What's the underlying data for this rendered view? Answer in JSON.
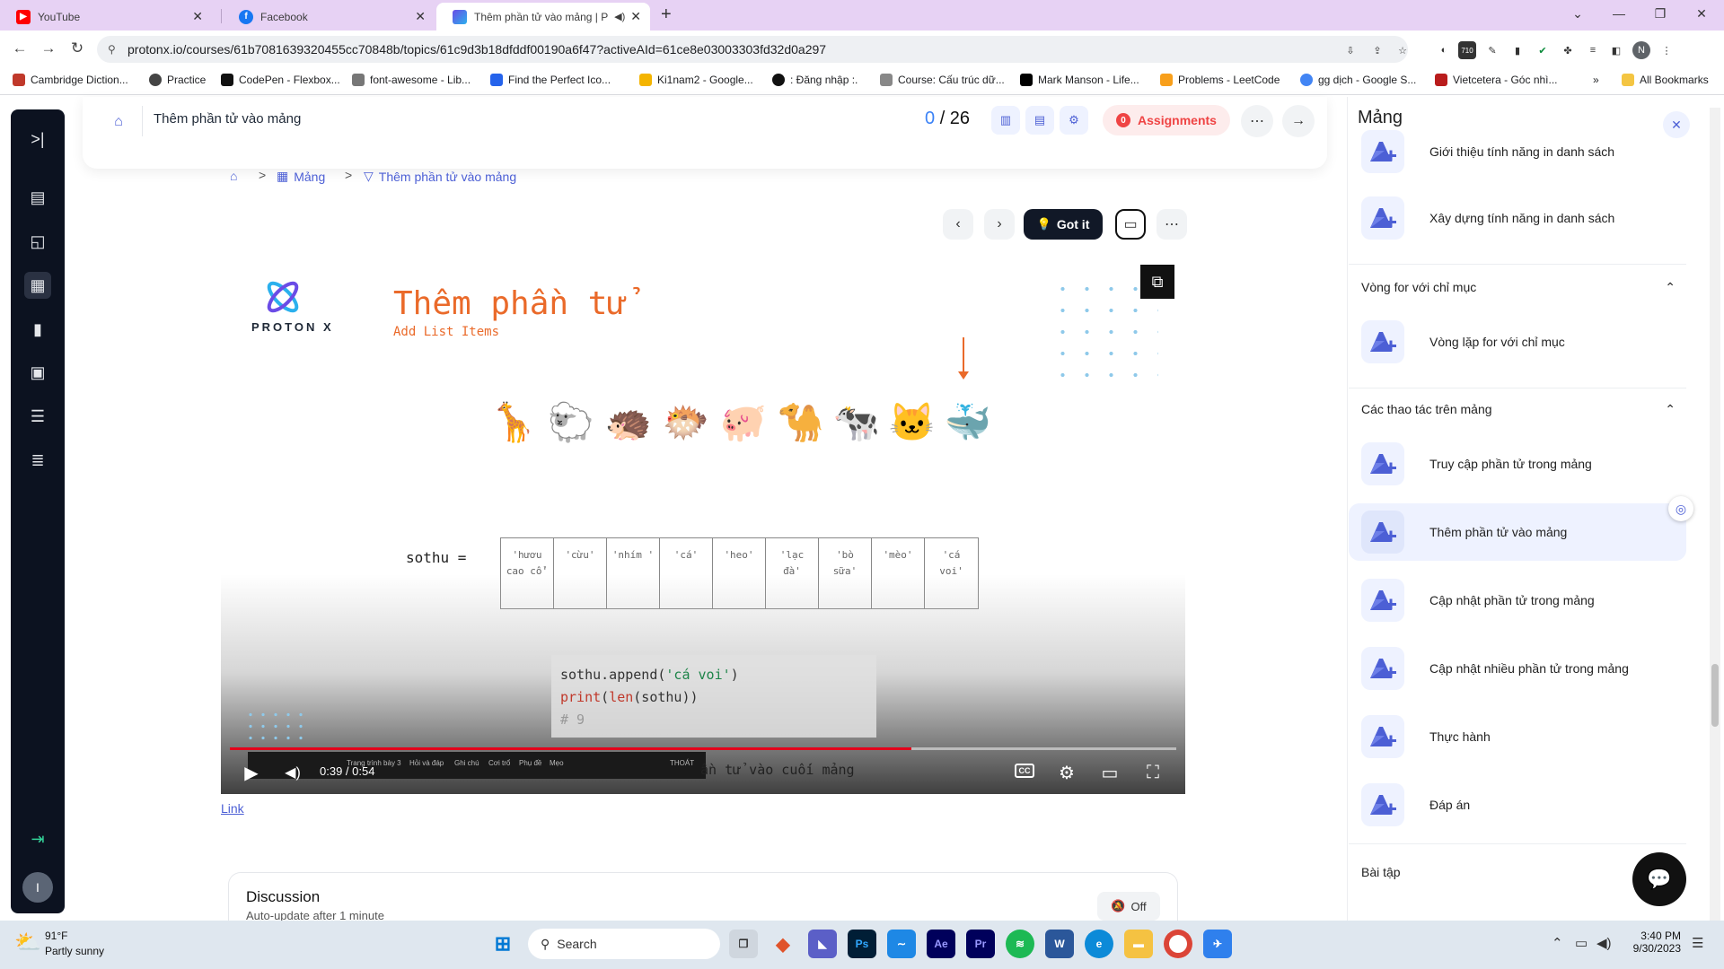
{
  "browser": {
    "tabs": [
      {
        "title": "YouTube",
        "icon": "youtube-icon",
        "color": "#ff0000"
      },
      {
        "title": "Facebook",
        "icon": "facebook-icon",
        "color": "#1877f2"
      },
      {
        "title": "Thêm phần tử vào mảng | P",
        "icon": "protonx-icon",
        "color": "#6b4ce6",
        "active": true
      }
    ],
    "url": "protonx.io/courses/61b7081639320455cc70848b/topics/61c9d3b18dfddf00190a6f47?activeAId=61ce8e03003303fd32d0a297",
    "extension_badge": "710",
    "profile_initial": "N",
    "bookmarks": [
      "Cambridge Diction...",
      "Practice",
      "CodePen - Flexbox...",
      "font-awesome - Lib...",
      "Find the Perfect Ico...",
      "Ki1nam2 - Google...",
      ": Đăng nhập :.",
      "Course: Cấu trúc dữ...",
      "Mark Manson - Life...",
      "Problems - LeetCode",
      "gg dịch - Google S...",
      "Vietcetera - Góc nhì..."
    ],
    "all_bookmarks": "All Bookmarks",
    "more_bookmarks": "»"
  },
  "course": {
    "title": "Thêm phần tử vào mảng",
    "progress_current": "0",
    "progress_total": "/ 26",
    "assignments_count": "0",
    "assignments_label": "Assignments"
  },
  "breadcrumb": {
    "items": [
      "Mảng",
      "Thêm phần tử vào mảng"
    ],
    "sep": ">"
  },
  "lesson_controls": {
    "got_it": "Got it"
  },
  "video": {
    "logo_text": "PROTON X",
    "title": "Thêm phần tử",
    "subtitle": "Add List Items",
    "animals": [
      "🦒",
      "🐑",
      "🦔",
      "🐡",
      "🐖",
      "🐪",
      "🐄",
      "🐱",
      "🐳"
    ],
    "var_label": "sothu =",
    "array": [
      "'hươu cao cổ'",
      "'cừu'",
      "'nhím '",
      "'cá'",
      "'heo'",
      "'lạc đà'",
      "'bò sữa'",
      "'mèo'",
      "'cá voi'"
    ],
    "code": {
      "line1_prefix": "sothu.append(",
      "line1_str": "'cá voi'",
      "line1_suffix": ")",
      "line2_kw1": "print",
      "line2_open": "(",
      "line2_kw2": "len",
      "line2_rest": "(sothu))",
      "line3": "# 9"
    },
    "caption": "ần tử vào cuối mảng",
    "time": "0:39 / 0:54",
    "cc": "CC",
    "progress": 0.72,
    "inner_bar": {
      "label1": "Trang trình bày 3",
      "label2": "THOÁT",
      "items": [
        "Hỏi và đáp",
        "Ghi chú",
        "Cơi trổ",
        "Phụ đề",
        "Mẹo"
      ]
    }
  },
  "link_label": "Link",
  "discussion": {
    "title": "Discussion",
    "subtitle": "Auto-update after 1 minute",
    "toggle": "Off"
  },
  "sidebar": {
    "title": "Mảng",
    "items_top": [
      {
        "label": "Giới thiệu tính năng in danh sách"
      },
      {
        "label": "Xây dựng tính năng in danh sách"
      }
    ],
    "section1": "Vòng for với chỉ mục",
    "items_s1": [
      {
        "label": "Vòng lặp for với chỉ mục"
      }
    ],
    "section2": "Các thao tác trên mảng",
    "items_s2": [
      {
        "label": "Truy cập phần tử trong mảng"
      },
      {
        "label": "Thêm phần tử vào mảng",
        "active": true
      },
      {
        "label": "Cập nhật phần tử trong mảng"
      },
      {
        "label": "Cập nhật nhiều phần tử trong mảng"
      },
      {
        "label": "Thực hành"
      },
      {
        "label": "Đáp án"
      }
    ],
    "section3": "Bài tập",
    "accent": "#4c5fd5"
  },
  "taskbar": {
    "weather_temp": "91°F",
    "weather_desc": "Partly sunny",
    "search": "Search",
    "time": "3:40 PM",
    "date": "9/30/2023",
    "apps": [
      "Ps",
      "Ae",
      "Pr",
      "W"
    ]
  }
}
